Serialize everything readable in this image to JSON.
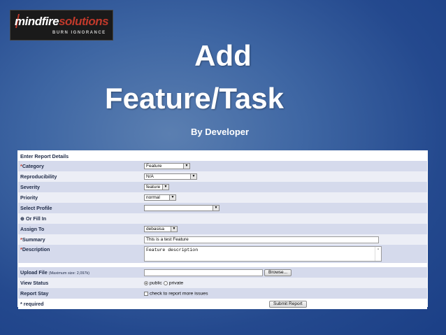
{
  "logo": {
    "brand_main": "mindfire",
    "brand_accent": "solutions",
    "tagline": "BURN IGNORANCE"
  },
  "slide": {
    "title_line1": "Add",
    "title_line2": "Feature/Task",
    "subtitle": "By Developer"
  },
  "form": {
    "header": "Enter Report Details",
    "category": {
      "label": "Category",
      "value": "Feature"
    },
    "reproducibility": {
      "label": "Reproducibility",
      "value": "N/A"
    },
    "severity": {
      "label": "Severity",
      "value": "feature"
    },
    "priority": {
      "label": "Priority",
      "value": "normal"
    },
    "select_profile": {
      "label": "Select Profile",
      "value": ""
    },
    "or_fill_in": {
      "label": "Or Fill In"
    },
    "assign_to": {
      "label": "Assign To",
      "value": "debasisa"
    },
    "summary": {
      "label": "Summary",
      "value": "This is a test Feature"
    },
    "description": {
      "label": "Description",
      "value": "Feature description"
    },
    "upload_file": {
      "label": "Upload File",
      "note": "(Maximum size: 2,097k)",
      "browse_label": "Browse..."
    },
    "view_status": {
      "label": "View Status",
      "option_public": "public",
      "option_private": "private",
      "selected": "public"
    },
    "report_stay": {
      "label": "Report Stay",
      "checkbox_label": "check to report more issues",
      "checked": false
    },
    "required_mark": "*",
    "required_note": "* required",
    "submit_label": "Submit Report"
  },
  "colors": {
    "background": "#24498e",
    "row_odd": "#d5daec",
    "row_even": "#eceef6",
    "label_text": "#1e2a46",
    "required": "#c0392b"
  },
  "icons": {
    "radio_marker": "radio-icon",
    "dropdown": "chevron-down-icon"
  }
}
